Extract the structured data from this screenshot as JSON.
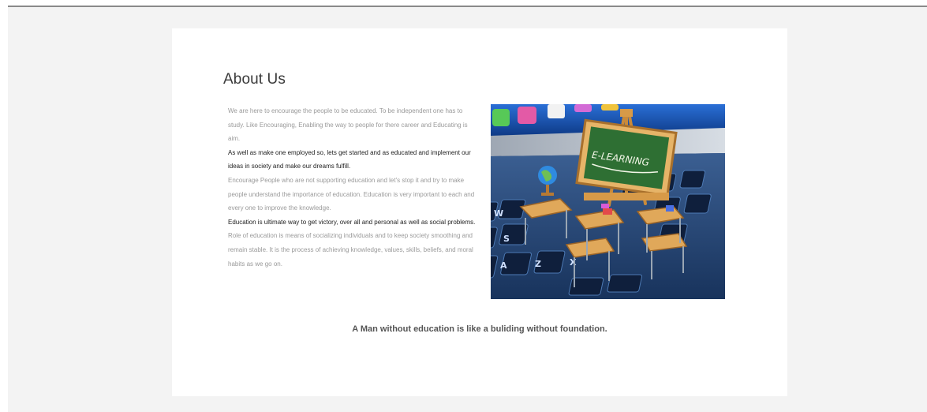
{
  "about": {
    "title": "About Us",
    "paragraphs": [
      {
        "text": "We are here to encourage the people to be educated. To be independent one has to study. Like Encouraging, Enabling the way to people for there career and Educating is aim.",
        "style": "light"
      },
      {
        "text": "As well as make one employed so, lets get started and as educated and implement our ideas in society and make our dreams fulfill.",
        "style": "dark"
      },
      {
        "text": "Encourage People who are not supporting education and let's stop it and try to make people understand the importance of education. Education is very important to each and every one to improve the knowledge.",
        "style": "light"
      },
      {
        "text": "Education is ultimate way to get victory, over all and personal as well as social problems.",
        "style": "dark"
      },
      {
        "text": "Role of education is means of socializing individuals and to keep society smoothing and remain stable. It is the process of achieving knowledge, values, skills, beliefs, and moral habits as we go on.",
        "style": "light"
      }
    ],
    "image": {
      "board_text": "E-LEARNING",
      "keys": [
        "W",
        "S",
        "A",
        "Z",
        "X"
      ]
    },
    "quote": "A Man without education is like a buliding without foundation."
  }
}
